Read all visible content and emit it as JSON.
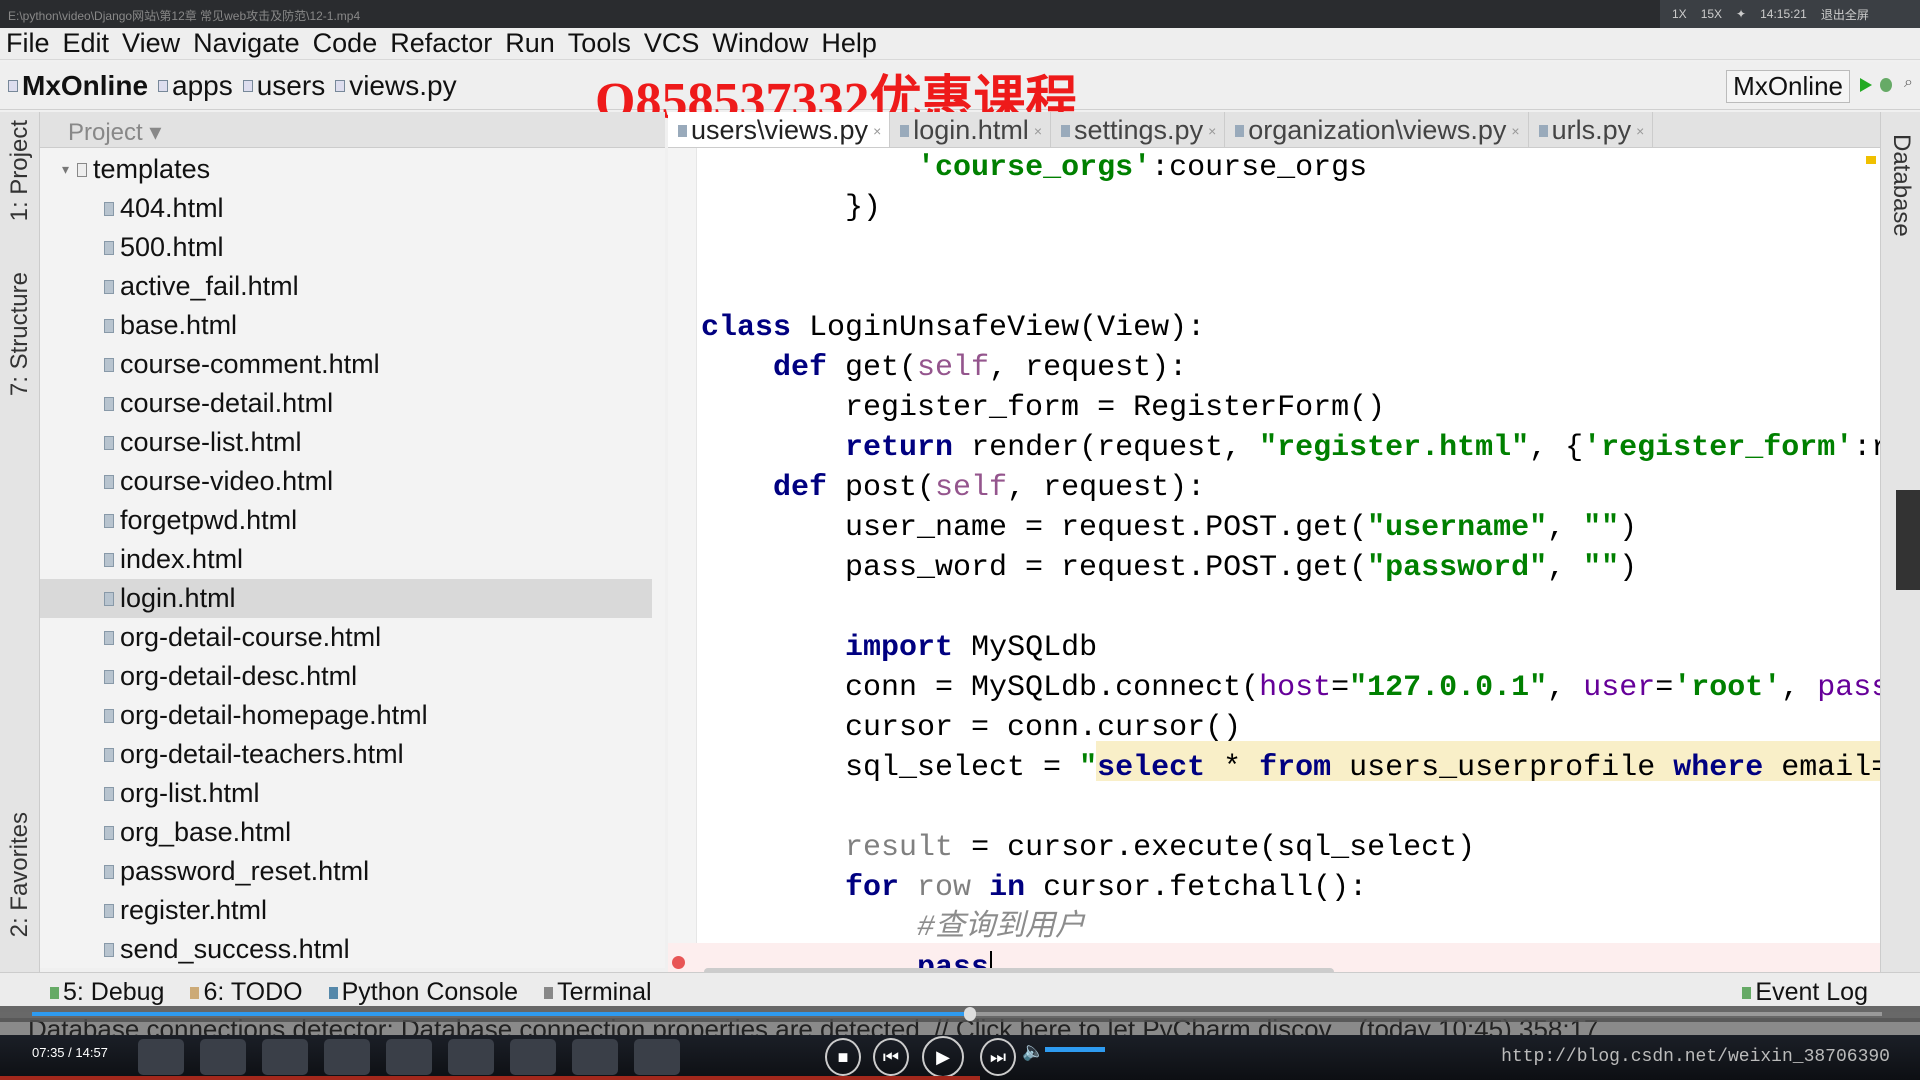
{
  "window": {
    "video_path": "E:\\python\\video\\Django网站\\第12章 常见web攻击及防范\\12-1.mp4",
    "speed1": "1X",
    "speed2": "15X",
    "clock": "14:15:21",
    "exit_fullscreen": "退出全屏"
  },
  "menu": [
    "File",
    "Edit",
    "View",
    "Navigate",
    "Code",
    "Refactor",
    "Run",
    "Tools",
    "VCS",
    "Window",
    "Help"
  ],
  "breadcrumb": [
    "MxOnline",
    "apps",
    "users",
    "views.py"
  ],
  "promo": "Q858537332优惠课程",
  "run_config": "MxOnline",
  "sidebar_left": {
    "project": "1: Project",
    "structure": "7: Structure",
    "favorites": "2: Favorites"
  },
  "sidebar_right": {
    "database": "Database"
  },
  "project_panel": {
    "title": "Project",
    "folder": "templates",
    "files": [
      "404.html",
      "500.html",
      "active_fail.html",
      "base.html",
      "course-comment.html",
      "course-detail.html",
      "course-list.html",
      "course-video.html",
      "forgetpwd.html",
      "index.html",
      "login.html",
      "org-detail-course.html",
      "org-detail-desc.html",
      "org-detail-homepage.html",
      "org-detail-teachers.html",
      "org-list.html",
      "org_base.html",
      "password_reset.html",
      "register.html",
      "send_success.html"
    ],
    "selected": "login.html"
  },
  "tabs": [
    {
      "label": "users\\views.py",
      "active": true
    },
    {
      "label": "login.html"
    },
    {
      "label": "settings.py"
    },
    {
      "label": "organization\\views.py"
    },
    {
      "label": "urls.py"
    }
  ],
  "code": [
    [
      [
        "            ",
        "plain"
      ],
      [
        "'course_orgs'",
        "str"
      ],
      [
        ":course_orgs",
        "plain"
      ]
    ],
    [
      [
        "        })",
        "plain"
      ]
    ],
    [],
    [],
    [
      [
        "class ",
        "kw"
      ],
      [
        "LoginUnsafeView(View):",
        "plain"
      ]
    ],
    [
      [
        "    ",
        "plain"
      ],
      [
        "def ",
        "kw"
      ],
      [
        "get(",
        "plain"
      ],
      [
        "self",
        "self"
      ],
      [
        ", request):",
        "plain"
      ]
    ],
    [
      [
        "        register_form = RegisterForm()",
        "plain"
      ]
    ],
    [
      [
        "        ",
        "plain"
      ],
      [
        "return ",
        "kw"
      ],
      [
        "render(request, ",
        "plain"
      ],
      [
        "\"register.html\"",
        "str"
      ],
      [
        ", {",
        "plain"
      ],
      [
        "'register_form'",
        "str"
      ],
      [
        ":r",
        "plain"
      ]
    ],
    [
      [
        "    ",
        "plain"
      ],
      [
        "def ",
        "kw"
      ],
      [
        "post(",
        "plain"
      ],
      [
        "self",
        "self"
      ],
      [
        ", request):",
        "plain"
      ]
    ],
    [
      [
        "        user_name = request.POST.get(",
        "plain"
      ],
      [
        "\"username\"",
        "str"
      ],
      [
        ", ",
        "plain"
      ],
      [
        "\"\"",
        "str"
      ],
      [
        ")",
        "plain"
      ]
    ],
    [
      [
        "        pass_word = request.POST.get(",
        "plain"
      ],
      [
        "\"password\"",
        "str"
      ],
      [
        ", ",
        "plain"
      ],
      [
        "\"\"",
        "str"
      ],
      [
        ")",
        "plain"
      ]
    ],
    [],
    [
      [
        "        ",
        "plain"
      ],
      [
        "import ",
        "kw"
      ],
      [
        "MySQLdb",
        "plain"
      ]
    ],
    [
      [
        "        conn = MySQLdb.connect(",
        "plain"
      ],
      [
        "host",
        "param"
      ],
      [
        "=",
        "plain"
      ],
      [
        "\"127.0.0.1\"",
        "str"
      ],
      [
        ", ",
        "plain"
      ],
      [
        "user",
        "param"
      ],
      [
        "=",
        "plain"
      ],
      [
        "'root'",
        "str"
      ],
      [
        ", ",
        "plain"
      ],
      [
        "pass",
        "param"
      ]
    ],
    [
      [
        "        cursor = conn.cursor()",
        "plain"
      ]
    ],
    [
      [
        "        sql_select = ",
        "plain"
      ],
      [
        "\"",
        "str"
      ],
      [
        "select",
        "kw"
      ],
      [
        " * ",
        "plain"
      ],
      [
        "from",
        "kw"
      ],
      [
        " users_userprofile ",
        "plain"
      ],
      [
        "where",
        "kw"
      ],
      [
        " email=",
        "plain"
      ]
    ],
    [],
    [
      [
        "        ",
        "plain"
      ],
      [
        "result",
        "gray"
      ],
      [
        " = cursor.execute(sql_select)",
        "plain"
      ]
    ],
    [
      [
        "        ",
        "plain"
      ],
      [
        "for ",
        "kw"
      ],
      [
        "row ",
        "gray"
      ],
      [
        "in ",
        "kw"
      ],
      [
        "cursor.fetchall():",
        "plain"
      ]
    ],
    [
      [
        "            ",
        "plain"
      ],
      [
        "#查询到用户",
        "cmt"
      ]
    ],
    [
      [
        "            ",
        "plain"
      ],
      [
        "pass",
        "kw"
      ]
    ]
  ],
  "bottom_tabs": [
    "5: Debug",
    "6: TODO",
    "Python Console",
    "Terminal"
  ],
  "event_log": "Event Log",
  "status": "Database connections detector: Database connection properties are detected. // Click here to let PyCharm discov... (today 10:45)  358:17",
  "player": {
    "time": "07:35 / 14:57",
    "progress": 0.507,
    "volume": 0.6,
    "watermark": "http://blog.csdn.net/weixin_38706390"
  }
}
